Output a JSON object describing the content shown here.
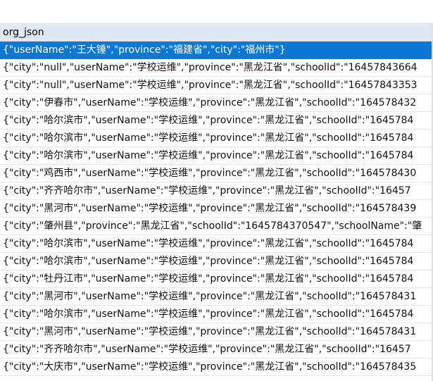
{
  "header": {
    "column": "org_json"
  },
  "rows": [
    "{\"userName\":\"王大锤\",\"province\":\"福建省\",\"city\":\"福州市\"}",
    "{\"city\":\"null\",\"userName\":\"学校运维\",\"province\":\"黑龙江省\",\"schoolId\":\"16457843664",
    "{\"city\":\"null\",\"userName\":\"学校运维\",\"province\":\"黑龙江省\",\"schoolId\":\"16457843353",
    "{\"city\":\"伊春市\",\"userName\":\"学校运维\",\"province\":\"黑龙江省\",\"schoolId\":\"164578432",
    "{\"city\":\"哈尔滨市\",\"userName\":\"学校运维\",\"province\":\"黑龙江省\",\"schoolId\":\"1645784",
    "{\"city\":\"哈尔滨市\",\"userName\":\"学校运维\",\"province\":\"黑龙江省\",\"schoolId\":\"1645784",
    "{\"city\":\"哈尔滨市\",\"userName\":\"学校运维\",\"province\":\"黑龙江省\",\"schoolId\":\"1645784",
    "{\"city\":\"鸡西市\",\"userName\":\"学校运维\",\"province\":\"黑龙江省\",\"schoolId\":\"164578430",
    "{\"city\":\"齐齐哈尔市\",\"userName\":\"学校运维\",\"province\":\"黑龙江省\",\"schoolId\":\"16457",
    "{\"city\":\"黑河市\",\"userName\":\"学校运维\",\"province\":\"黑龙江省\",\"schoolId\":\"164578439",
    "{\"city\":\"肇州县\",\"province\":\"黑龙江省\",\"schoolId\":\"1645784370547\",\"schoolName\":\"肇",
    "{\"city\":\"哈尔滨市\",\"userName\":\"学校运维\",\"province\":\"黑龙江省\",\"schoolId\":\"1645784",
    "{\"city\":\"哈尔滨市\",\"userName\":\"学校运维\",\"province\":\"黑龙江省\",\"schoolId\":\"1645784",
    "{\"city\":\"牡丹江市\",\"userName\":\"学校运维\",\"province\":\"黑龙江省\",\"schoolId\":\"1645784",
    "{\"city\":\"黑河市\",\"userName\":\"学校运维\",\"province\":\"黑龙江省\",\"schoolId\":\"164578431",
    "{\"city\":\"哈尔滨市\",\"userName\":\"学校运维\",\"province\":\"黑龙江省\",\"schoolId\":\"1645784",
    "{\"city\":\"黑河市\",\"userName\":\"学校运维\",\"province\":\"黑龙江省\",\"schoolId\":\"164578431",
    "{\"city\":\"齐齐哈尔市\",\"userName\":\"学校运维\",\"province\":\"黑龙江省\",\"schoolId\":\"16457",
    "{\"city\":\"大庆市\",\"userName\":\"学校运维\",\"province\":\"黑龙江省\",\"schoolId\":\"164578435"
  ],
  "selected_index": 0,
  "colors": {
    "header_bg": "#dfe9f6",
    "selected_bg": "#0b78d6",
    "row_text": "#111111",
    "selected_text": "#ffffff"
  }
}
